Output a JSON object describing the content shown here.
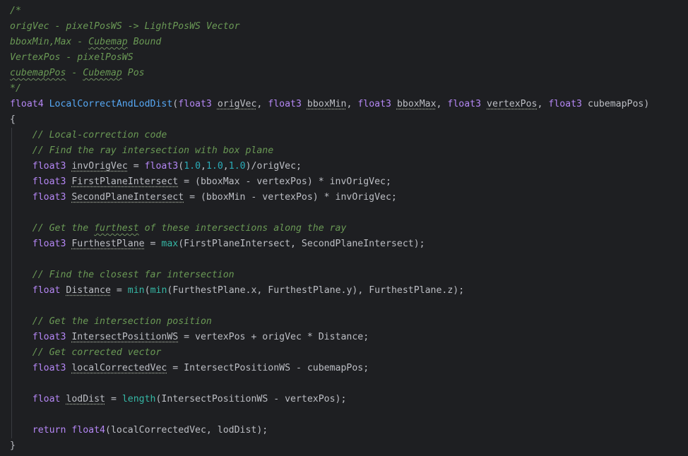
{
  "editor": {
    "language": "HLSL",
    "colors": {
      "background": "#1e1f22",
      "text": "#bcbec4",
      "comment": "#6a9955",
      "type": "#b587f5",
      "function": "#56a8f5",
      "builtin": "#35b8a6",
      "number": "#2aacb8"
    },
    "lines": [
      "/*",
      "origVec - pixelPosWS -> LightPosWS Vector",
      "bboxMin,Max - Cubemap Bound",
      "VertexPos - pixelPosWS",
      "cubemapPos - Cubemap Pos",
      "*/",
      "float4 LocalCorrectAndLodDist(float3 origVec, float3 bboxMin, float3 bboxMax, float3 vertexPos, float3 cubemapPos)",
      "{",
      "    // Local-correction code",
      "    // Find the ray intersection with box plane",
      "    float3 invOrigVec = float3(1.0,1.0,1.0)/origVec;",
      "    float3 FirstPlaneIntersect = (bboxMax - vertexPos) * invOrigVec;",
      "    float3 SecondPlaneIntersect = (bboxMin - vertexPos) * invOrigVec;",
      "",
      "    // Get the furthest of these intersections along the ray",
      "    float3 FurthestPlane = max(FirstPlaneIntersect, SecondPlaneIntersect);",
      "",
      "    // Find the closest far intersection",
      "    float Distance = min(min(FurthestPlane.x, FurthestPlane.y), FurthestPlane.z);",
      "",
      "    // Get the intersection position",
      "    float3 IntersectPositionWS = vertexPos + origVec * Distance;",
      "    // Get corrected vector",
      "    float3 localCorrectedVec = IntersectPositionWS - cubemapPos;",
      "",
      "    float lodDist = length(IntersectPositionWS - vertexPos);",
      "",
      "    return float4(localCorrectedVec, lodDist);",
      "}"
    ]
  }
}
